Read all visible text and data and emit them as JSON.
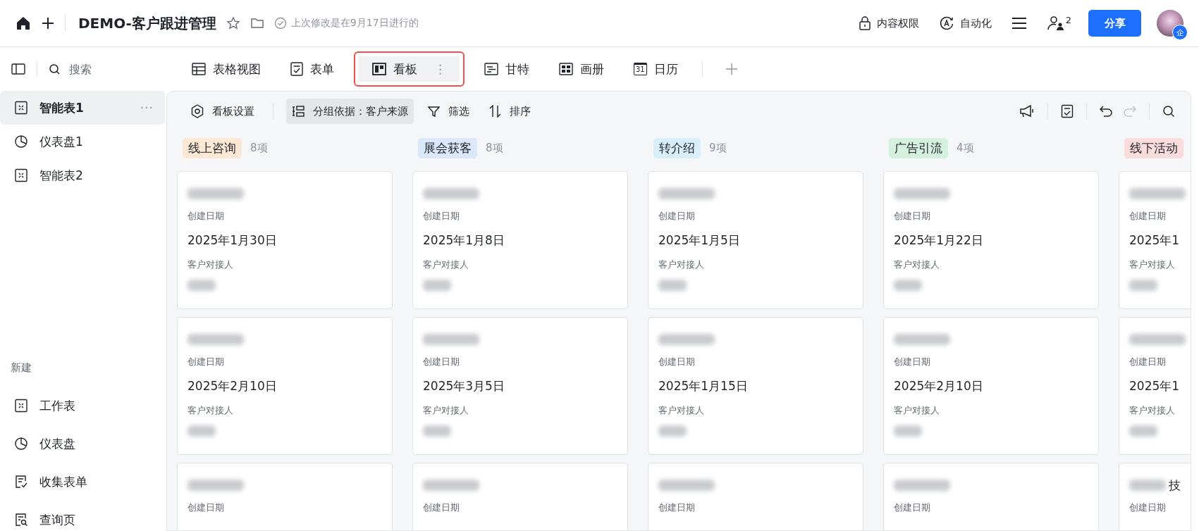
{
  "topbar": {
    "title": "DEMO-客户跟进管理",
    "last_modified": "上次修改是在9月17日进行的",
    "permissions": "内容权限",
    "automation": "自动化",
    "collaborator_count": "2",
    "share": "分享",
    "avatar_badge": "企"
  },
  "sidebar": {
    "search_placeholder": "搜索",
    "items": [
      {
        "label": "智能表1",
        "kind": "sheet",
        "selected": true,
        "more": "···"
      },
      {
        "label": "仪表盘1",
        "kind": "dashboard",
        "selected": false
      },
      {
        "label": "智能表2",
        "kind": "sheet",
        "selected": false
      }
    ],
    "new_section": {
      "heading": "新建",
      "items": [
        {
          "label": "工作表",
          "kind": "sheet"
        },
        {
          "label": "仪表盘",
          "kind": "dashboard"
        },
        {
          "label": "收集表单",
          "kind": "form"
        },
        {
          "label": "查询页",
          "kind": "query"
        }
      ]
    }
  },
  "tabs": [
    {
      "label": "表格视图",
      "kind": "grid",
      "selected": false
    },
    {
      "label": "表单",
      "kind": "form",
      "selected": false
    },
    {
      "label": "看板",
      "kind": "kanban",
      "selected": true,
      "more": "⋮"
    },
    {
      "label": "甘特",
      "kind": "gantt",
      "selected": false
    },
    {
      "label": "画册",
      "kind": "gallery",
      "selected": false
    },
    {
      "label": "日历",
      "kind": "calendar",
      "selected": false,
      "icon_text": "31"
    }
  ],
  "toolbar": {
    "settings": "看板设置",
    "group_by": "分组依据：客户来源",
    "filter": "筛选",
    "sort": "排序",
    "redo_disabled": true
  },
  "columns": [
    {
      "label": "线上咨询",
      "count": "8项",
      "color": "#fde8d6",
      "cards": [
        {
          "date_label": "创建日期",
          "date": "2025年1月30日",
          "contact_label": "客户对接人"
        },
        {
          "date_label": "创建日期",
          "date": "2025年2月10日",
          "contact_label": "客户对接人"
        },
        {
          "date_label": "创建日期"
        }
      ]
    },
    {
      "label": "展会获客",
      "count": "8项",
      "color": "#dbe7fb",
      "cards": [
        {
          "date_label": "创建日期",
          "date": "2025年1月8日",
          "contact_label": "客户对接人"
        },
        {
          "date_label": "创建日期",
          "date": "2025年3月5日",
          "contact_label": "客户对接人"
        },
        {
          "date_label": "创建日期"
        }
      ]
    },
    {
      "label": "转介绍",
      "count": "9项",
      "color": "#d8eefb",
      "cards": [
        {
          "date_label": "创建日期",
          "date": "2025年1月5日",
          "contact_label": "客户对接人"
        },
        {
          "date_label": "创建日期",
          "date": "2025年1月15日",
          "contact_label": "客户对接人"
        },
        {
          "date_label": "创建日期"
        }
      ]
    },
    {
      "label": "广告引流",
      "count": "4项",
      "color": "#d4f0df",
      "cards": [
        {
          "date_label": "创建日期",
          "date": "2025年1月22日",
          "contact_label": "客户对接人"
        },
        {
          "date_label": "创建日期",
          "date": "2025年2月10日",
          "contact_label": "客户对接人"
        },
        {
          "date_label": "创建日期"
        }
      ]
    },
    {
      "label": "线下活动",
      "color": "#fbdcdc",
      "cards": [
        {
          "date_label": "创建日期",
          "date": "2025年1",
          "contact_label": "客户对接人"
        },
        {
          "date_label": "创建日期",
          "date": "2025年1",
          "contact_label": "客户对接人"
        },
        {
          "date_label": "创建日期",
          "title_tail": "技"
        }
      ]
    }
  ]
}
